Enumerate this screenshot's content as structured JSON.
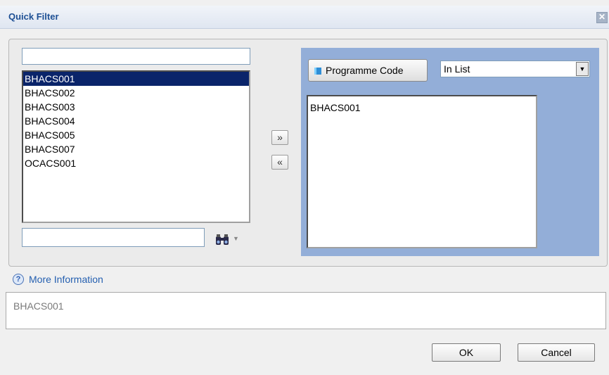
{
  "dialog": {
    "title": "Quick Filter",
    "close_glyph": "✕"
  },
  "left": {
    "search_value": "",
    "items": [
      "BHACS001",
      "BHACS002",
      "BHACS003",
      "BHACS004",
      "BHACS005",
      "BHACS007",
      "OCACS001"
    ],
    "selected_index": 0,
    "find_value": "",
    "find_icon": "binoculars-icon",
    "find_dropdown_glyph": "▼"
  },
  "move": {
    "add_glyph": "»",
    "remove_glyph": "«"
  },
  "right": {
    "field_button_label": "Programme Code",
    "operator_value": "In List",
    "operator_arrow": "▼",
    "selected_values": "BHACS001"
  },
  "info": {
    "link_label": "More Information",
    "help_glyph": "?",
    "text": "BHACS001"
  },
  "buttons": {
    "ok_label": "OK",
    "cancel_label": "Cancel"
  },
  "colors": {
    "accent": "#93aed8",
    "selection": "#0a246a",
    "title": "#1d4f94"
  }
}
